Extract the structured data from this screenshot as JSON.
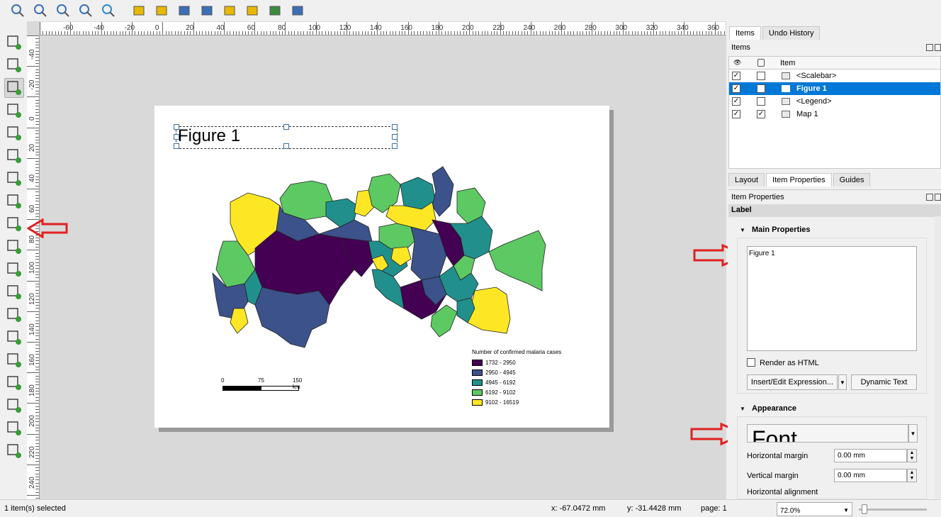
{
  "toolbar": {
    "icons": [
      "zoom-in-icon",
      "zoom-out-icon",
      "zoom-actual-icon",
      "zoom-full-icon",
      "refresh-icon",
      "lock-icon",
      "unlock-icon",
      "group-icon",
      "ungroup-icon",
      "raise-icon",
      "align-icon",
      "distribute-icon",
      "resize-icon"
    ]
  },
  "left_tools": {
    "icons": [
      "pan-icon",
      "zoom-tool-icon",
      "select-move-icon",
      "move-content-icon",
      "edit-nodes-icon",
      "add-map-icon",
      "add-3d-map-icon",
      "add-picture-icon",
      "add-label-icon",
      "add-legend-icon",
      "add-scalebar-icon",
      "add-north-arrow-icon",
      "add-shape-icon",
      "add-marker-icon",
      "add-arrow-icon",
      "add-node-item-icon",
      "add-html-icon",
      "add-attribute-table-icon",
      "add-fixed-table-icon"
    ]
  },
  "ruler": {
    "h_labels": [
      "-60",
      "-40",
      "-20",
      "0",
      "20",
      "40",
      "60",
      "80",
      "100",
      "120",
      "140",
      "160",
      "180",
      "200",
      "220",
      "240",
      "260",
      "280",
      "300",
      "320",
      "340",
      "360"
    ],
    "v_labels": [
      "-40",
      "-20",
      "0",
      "20",
      "40",
      "60",
      "80",
      "100",
      "120",
      "140",
      "160",
      "180",
      "200",
      "220",
      "240"
    ]
  },
  "layout": {
    "label_text": "Figure 1",
    "legend": {
      "title": "Number of confirmed malaria cases",
      "entries": [
        {
          "label": "1732 - 2950",
          "color": "#440154"
        },
        {
          "label": "2950 - 4945",
          "color": "#3b528b"
        },
        {
          "label": "4945 - 6192",
          "color": "#21908d"
        },
        {
          "label": "6192 - 9102",
          "color": "#5dc963"
        },
        {
          "label": "9102 - 16519",
          "color": "#fde725"
        }
      ]
    },
    "scalebar": {
      "labels": [
        "0",
        "75",
        "150 km"
      ]
    }
  },
  "right_panel": {
    "top_tabs": [
      "Items",
      "Undo History"
    ],
    "items_title": "Items",
    "items_header": "Item",
    "items": [
      {
        "name": "<Scalebar>",
        "visible": "✓",
        "locked": ""
      },
      {
        "name": "Figure 1",
        "visible": "✓",
        "locked": ""
      },
      {
        "name": "<Legend>",
        "visible": "✓",
        "locked": ""
      },
      {
        "name": "Map 1",
        "visible": "✓",
        "locked": "✓"
      }
    ],
    "bottom_tabs": [
      "Layout",
      "Item Properties",
      "Guides"
    ],
    "props_title": "Item Properties",
    "item_type": "Label",
    "main_properties": "Main Properties",
    "label_value": "Figure 1",
    "render_html": "Render as HTML",
    "insert_expression": "Insert/Edit Expression...",
    "dynamic_text": "Dynamic Text",
    "appearance": "Appearance",
    "font_button": "Font",
    "h_margin_label": "Horizontal margin",
    "h_margin_value": "0.00 mm",
    "v_margin_label": "Vertical margin",
    "v_margin_value": "0.00 mm",
    "h_align_label": "Horizontal alignment"
  },
  "status": {
    "selected": "1 item(s) selected",
    "x": "x: -67.0472 mm",
    "y": "y: -31.4428 mm",
    "page": "page: 1",
    "zoom": "72.0%"
  }
}
